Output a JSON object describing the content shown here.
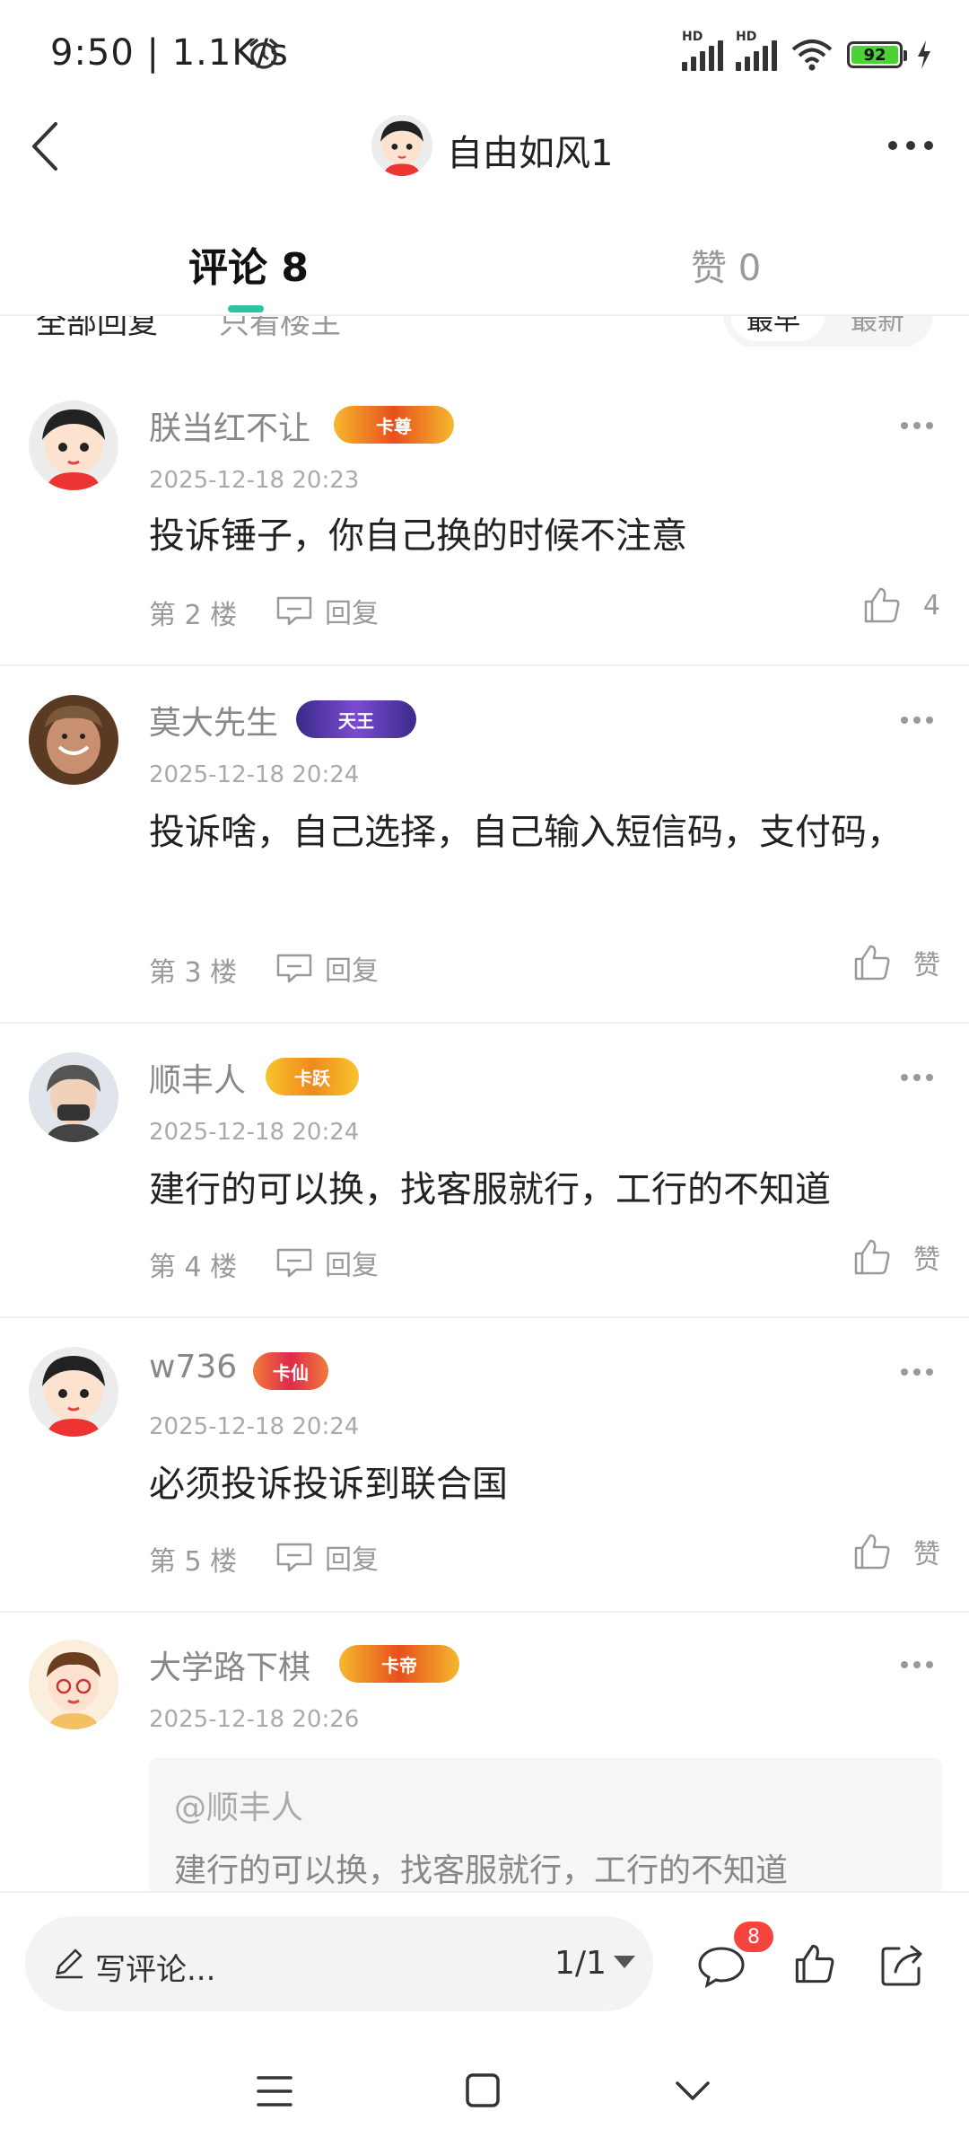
{
  "status_bar": {
    "time": "9:50 | 1.1K/s",
    "network_badge": "HD",
    "battery": "92"
  },
  "header": {
    "title": "自由如风1"
  },
  "tabs": {
    "comments_label": "评论 8",
    "likes_label": "赞 0"
  },
  "filter": {
    "all_replies": "全部回复",
    "only_op": "只看楼主",
    "sort_earliest": "最早",
    "sort_latest": "最新"
  },
  "comments": [
    {
      "user": "朕当红不让",
      "badge": "卡尊",
      "time": "2025-12-18 20:23",
      "text": "投诉锤子，你自己换的时候不注意",
      "floor": "第 2 楼",
      "reply_label": "回复",
      "like_label": "4"
    },
    {
      "user": "莫大先生",
      "badge": "天王",
      "time": "2025-12-18 20:24",
      "text": "投诉啥，自己选择，自己输入短信码，支付码，",
      "floor": "第 3 楼",
      "reply_label": "回复",
      "like_label": "赞"
    },
    {
      "user": "顺丰人",
      "badge": "卡跃",
      "time": "2025-12-18 20:24",
      "text": "建行的可以换，找客服就行，工行的不知道",
      "floor": "第 4 楼",
      "reply_label": "回复",
      "like_label": "赞"
    },
    {
      "user": "w736",
      "badge": "卡仙",
      "time": "2025-12-18 20:24",
      "text": "必须投诉投诉到联合国",
      "floor": "第 5 楼",
      "reply_label": "回复",
      "like_label": "赞"
    },
    {
      "user": "大学路下棋",
      "badge": "卡帝",
      "time": "2025-12-18 20:26",
      "quote_user": "@顺丰人",
      "quote_text": "建行的可以换，找客服就行，工行的不知道"
    }
  ],
  "bottom_bar": {
    "input_placeholder": "写评论...",
    "page_indicator": "1/1",
    "comment_count": "8"
  },
  "icons": {
    "back": "back-arrow-icon",
    "more": "more-icon",
    "reply": "reply-bubble-icon",
    "like": "thumbs-up-icon",
    "comment": "comment-icon",
    "share": "share-icon",
    "edit": "pencil-icon",
    "alarm": "alarm-icon"
  },
  "colors": {
    "accent": "#2ec4a0",
    "badge_red": "#f5443d"
  }
}
